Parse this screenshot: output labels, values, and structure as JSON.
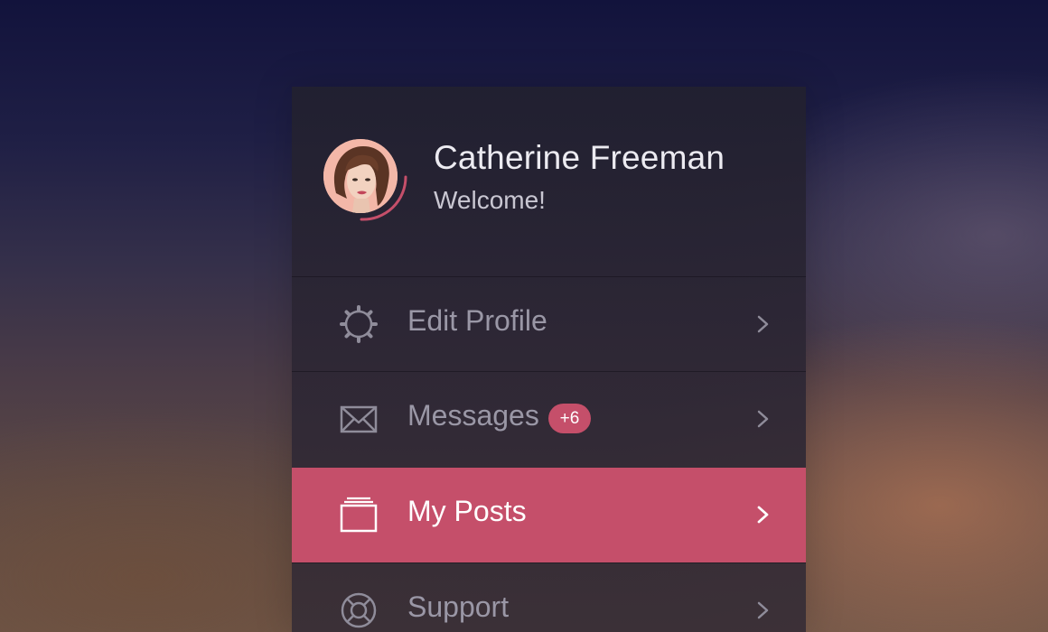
{
  "user": {
    "name": "Catherine Freeman",
    "welcome": "Welcome!"
  },
  "menu": {
    "items": [
      {
        "label": "Edit Profile",
        "icon": "gear-icon",
        "active": false
      },
      {
        "label": "Messages",
        "icon": "envelope-icon",
        "badge": "+6",
        "active": false
      },
      {
        "label": "My Posts",
        "icon": "posts-stack-icon",
        "active": true
      },
      {
        "label": "Support",
        "icon": "lifebuoy-icon",
        "active": false
      }
    ]
  },
  "colors": {
    "accent": "#c54f6a",
    "text_primary": "#ecebf1",
    "text_muted": "#9a97a6",
    "panel": "#23212f"
  }
}
